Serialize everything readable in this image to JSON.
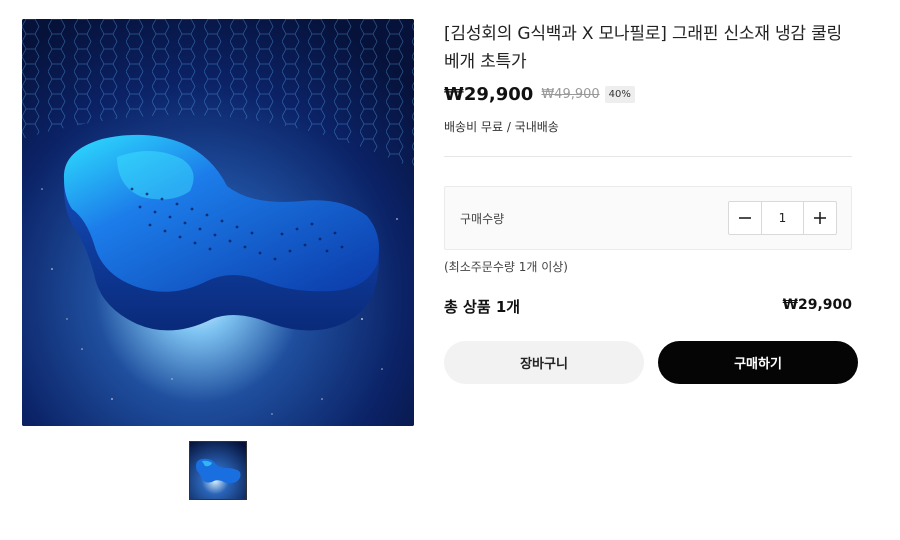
{
  "product": {
    "title": "[김성회의 G식백과 X 모나필로] 그래핀 신소재 냉감 쿨링 베개 초특가",
    "sale_price": "₩29,900",
    "original_price": "₩49,900",
    "discount": "40%",
    "shipping": "배송비 무료 / 국내배송",
    "image_subject": "blue-cooling-pillow-image"
  },
  "quantity": {
    "label": "구매수량",
    "value": "1",
    "minus_icon": "minus-icon",
    "plus_icon": "plus-icon",
    "min_order_note": "(최소주문수량 1개 이상)"
  },
  "total": {
    "label": "총 상품 1개",
    "price": "₩29,900"
  },
  "actions": {
    "cart_label": "장바구니",
    "buy_label": "구매하기"
  },
  "colors": {
    "buy_button": "#050505",
    "cart_button": "#f2f2f2",
    "image_background": "#0a1a4a"
  }
}
